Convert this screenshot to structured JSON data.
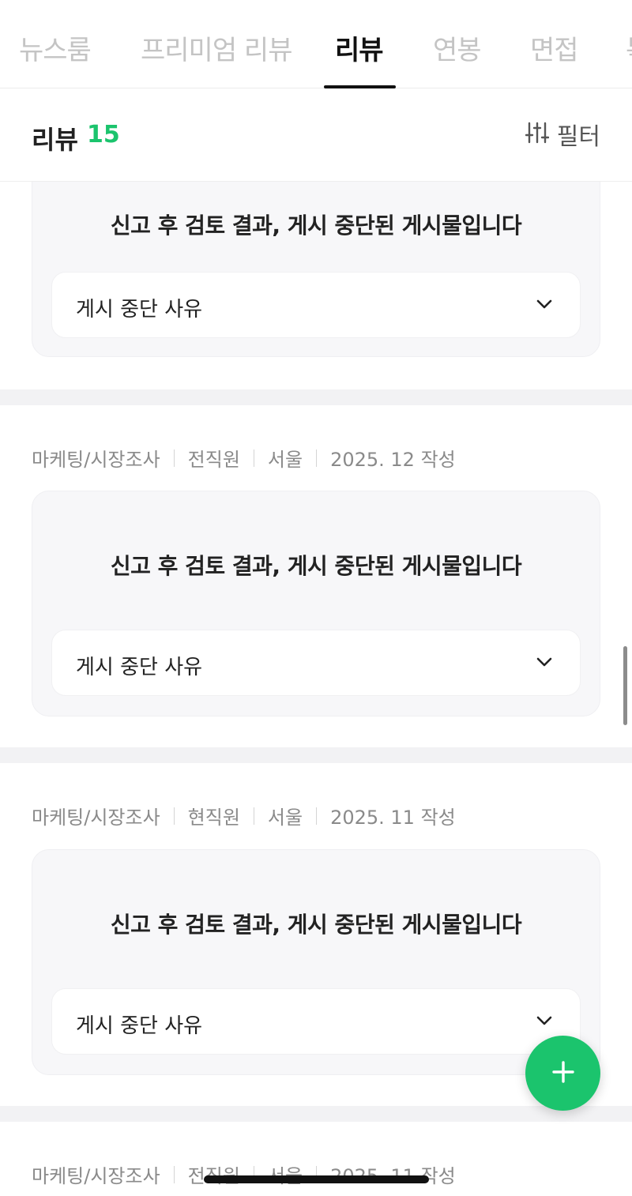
{
  "tabs": [
    {
      "label": "뉴스룸"
    },
    {
      "label": "프리미엄 리뷰"
    },
    {
      "label": "리뷰"
    },
    {
      "label": "연봉"
    },
    {
      "label": "면접"
    },
    {
      "label": "복"
    }
  ],
  "header": {
    "title": "리뷰",
    "count": "15",
    "filter_label": "필터"
  },
  "reviews": [
    {
      "notice": "신고 후 검토 결과, 게시 중단된 게시물입니다",
      "reason_label": "게시 중단 사유"
    },
    {
      "meta": [
        "마케팅/시장조사",
        "전직원",
        "서울",
        "2025. 12 작성"
      ],
      "notice": "신고 후 검토 결과, 게시 중단된 게시물입니다",
      "reason_label": "게시 중단 사유"
    },
    {
      "meta": [
        "마케팅/시장조사",
        "현직원",
        "서울",
        "2025. 11 작성"
      ],
      "notice": "신고 후 검토 결과, 게시 중단된 게시물입니다",
      "reason_label": "게시 중단 사유"
    },
    {
      "meta": [
        "마케팅/시장조사",
        "전직원",
        "서울",
        "2025. 11 작성"
      ]
    }
  ],
  "colors": {
    "accent": "#1bc46d",
    "card_bg": "#f7f7f9",
    "separator": "#f2f2f4"
  },
  "icons": {
    "filter": "sliders-icon",
    "chevron": "chevron-down-icon",
    "fab": "plus-icon"
  }
}
